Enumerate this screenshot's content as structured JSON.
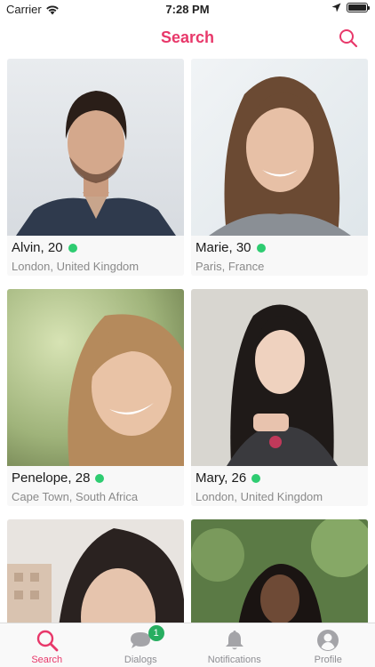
{
  "status_bar": {
    "carrier": "Carrier",
    "time": "7:28 PM"
  },
  "nav": {
    "title": "Search"
  },
  "profiles": [
    {
      "name_age": "Alvin, 20",
      "location": "London, United Kingdom",
      "online": true
    },
    {
      "name_age": "Marie, 30",
      "location": "Paris, France",
      "online": true
    },
    {
      "name_age": "Penelope, 28",
      "location": "Cape Town, South Africa",
      "online": true
    },
    {
      "name_age": "Mary, 26",
      "location": "London, United Kingdom",
      "online": true
    },
    {
      "name_age": "",
      "location": ""
    },
    {
      "name_age": "",
      "location": ""
    }
  ],
  "tabs": [
    {
      "label": "Search",
      "icon": "search-icon",
      "active": true
    },
    {
      "label": "Dialogs",
      "icon": "chat-bubble-icon",
      "badge": "1"
    },
    {
      "label": "Notifications",
      "icon": "bell-icon"
    },
    {
      "label": "Profile",
      "icon": "person-icon"
    }
  ],
  "colors": {
    "accent": "#e8386a",
    "online": "#2ecc71",
    "badge": "#27ae60"
  }
}
